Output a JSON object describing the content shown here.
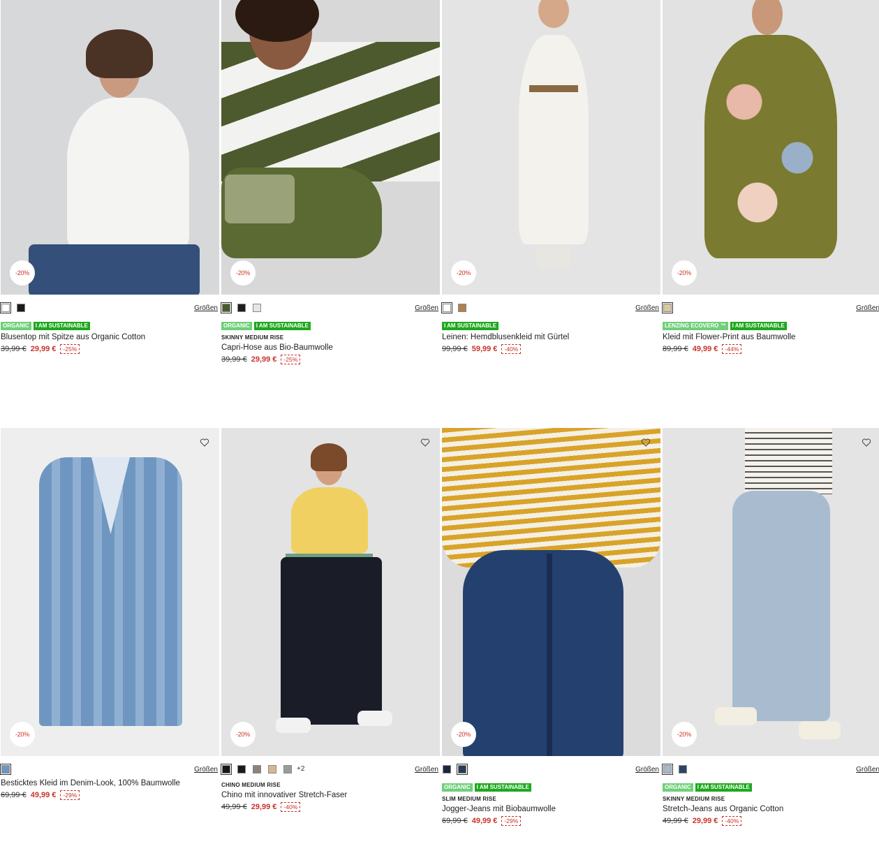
{
  "common": {
    "sizes_label": "Größen"
  },
  "products": [
    {
      "name": "Blusentop mit Spitze aus Organic Cotton",
      "badge": "-20%",
      "tags": [
        "ORGANIC",
        "I AM SUSTAINABLE"
      ],
      "fit": "",
      "old_price": "39,99 €",
      "new_price": "29,99 €",
      "discount": "-25%",
      "swatches": [
        "#ffffff",
        "#1b1b1b"
      ],
      "more": "",
      "heart": false
    },
    {
      "name": "Capri-Hose aus Bio-Baumwolle",
      "badge": "-20%",
      "tags": [
        "ORGANIC",
        "I AM SUSTAINABLE"
      ],
      "fit": "SKINNY MEDIUM RISE",
      "old_price": "39,99 €",
      "new_price": "29,99 €",
      "discount": "-25%",
      "swatches": [
        "#4a5a2a",
        "#1e1e22",
        "#e8e6e2"
      ],
      "more": "",
      "heart": false
    },
    {
      "name": "Leinen: Hemdblusenkleid mit Gürtel",
      "badge": "-20%",
      "tags": [
        "I AM SUSTAINABLE"
      ],
      "fit": "",
      "old_price": "99,99 €",
      "new_price": "59,99 €",
      "discount": "-40%",
      "swatches": [
        "#ffffff",
        "#b08050"
      ],
      "more": "",
      "heart": false
    },
    {
      "name": "Kleid mit Flower-Print aus Baumwolle",
      "badge": "-20%",
      "tags": [
        "LENZING ECOVERO ™",
        "I AM SUSTAINABLE"
      ],
      "fit": "",
      "old_price": "89,99 €",
      "new_price": "49,99 €",
      "discount": "-44%",
      "swatches": [
        "#d9c9a0"
      ],
      "more": "",
      "heart": false
    },
    {
      "name": "Besticktes Kleid im Denim-Look, 100% Baumwolle",
      "badge": "-20%",
      "tags": [],
      "fit": "",
      "old_price": "69,99 €",
      "new_price": "49,99 €",
      "discount": "-29%",
      "swatches": [
        "#6f96bf"
      ],
      "more": "",
      "heart": true
    },
    {
      "name": "Chino mit innovativer Stretch-Faser",
      "badge": "-20%",
      "tags": [],
      "fit": "CHINO MEDIUM RISE",
      "old_price": "49,99 €",
      "new_price": "29,99 €",
      "discount": "-40%",
      "swatches": [
        "#16171e",
        "#1a1a1a",
        "#8b8478",
        "#d6b890",
        "#9a9c98"
      ],
      "more": "+2",
      "heart": true
    },
    {
      "name": "Jogger-Jeans mit Biobaumwolle",
      "badge": "-20%",
      "tags": [
        "ORGANIC",
        "I AM SUSTAINABLE"
      ],
      "fit": "SLIM MEDIUM RISE",
      "old_price": "69,99 €",
      "new_price": "49,99 €",
      "discount": "-29%",
      "swatches": [
        "#1b2540",
        "#2a3a58"
      ],
      "more": "",
      "heart": true
    },
    {
      "name": "Stretch-Jeans aus Organic Cotton",
      "badge": "-20%",
      "tags": [
        "ORGANIC",
        "I AM SUSTAINABLE"
      ],
      "fit": "SKINNY MEDIUM RISE",
      "old_price": "49,99 €",
      "new_price": "29,99 €",
      "discount": "-40%",
      "swatches": [
        "#a8b8c8",
        "#2d4466"
      ],
      "more": "",
      "heart": true
    }
  ]
}
